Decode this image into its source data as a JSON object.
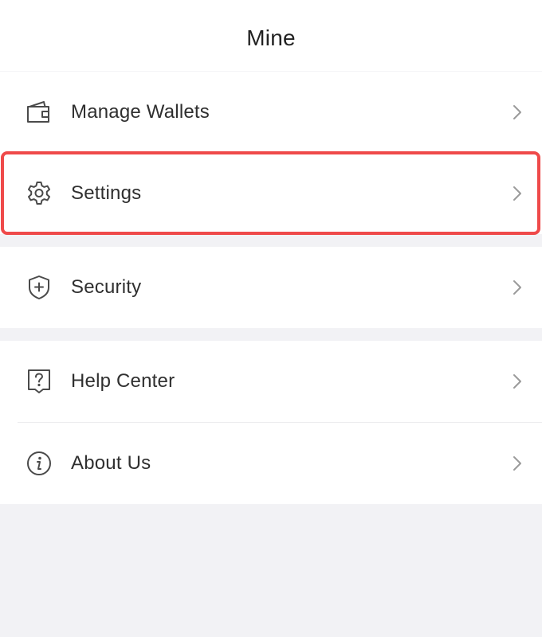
{
  "header": {
    "title": "Mine"
  },
  "groups": [
    {
      "items": [
        {
          "label": "Manage Wallets",
          "icon": "wallet-icon"
        },
        {
          "label": "Settings",
          "icon": "gear-icon"
        }
      ]
    },
    {
      "items": [
        {
          "label": "Security",
          "icon": "shield-plus-icon"
        }
      ]
    },
    {
      "items": [
        {
          "label": "Help Center",
          "icon": "help-icon"
        },
        {
          "label": "About Us",
          "icon": "info-icon"
        }
      ]
    }
  ],
  "highlight": {
    "target": "Settings",
    "color": "#ef4a4a"
  },
  "colors": {
    "background": "#f2f2f5",
    "surface": "#ffffff",
    "text": "#2f2f2f",
    "icon": "#4a4a4a",
    "chevron": "#9a9a9a"
  }
}
